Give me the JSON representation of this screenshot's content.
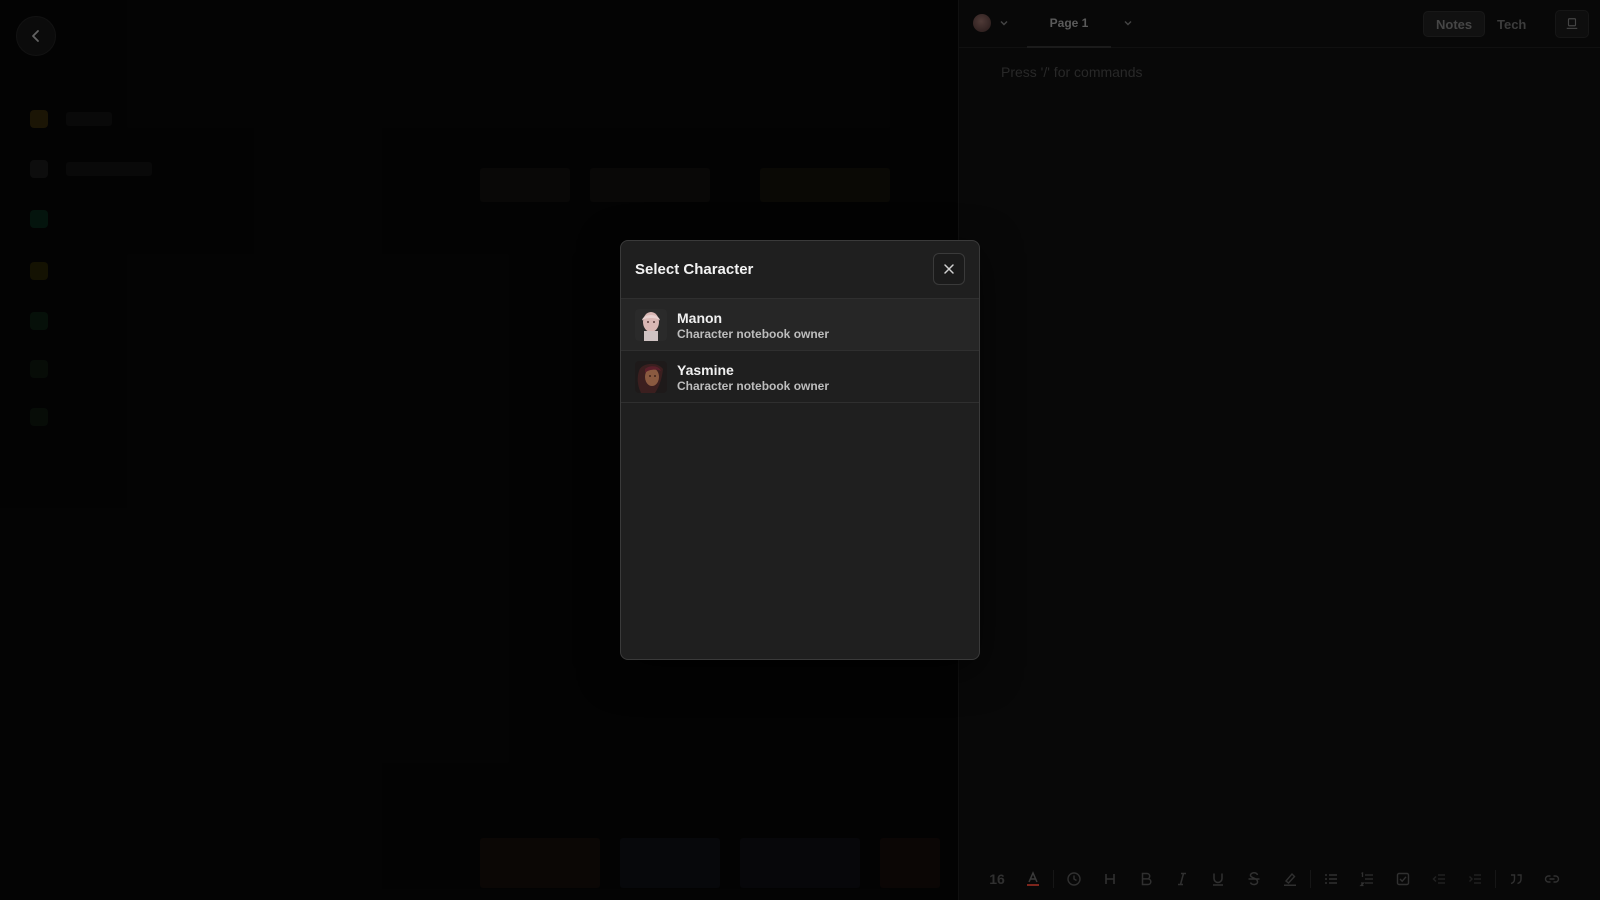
{
  "modal": {
    "title": "Select Character",
    "characters": [
      {
        "name": "Manon",
        "subtitle": "Character notebook owner",
        "avatar_icon": "manon-portrait"
      },
      {
        "name": "Yasmine",
        "subtitle": "Character notebook owner",
        "avatar_icon": "yasmine-portrait"
      }
    ]
  },
  "editor": {
    "page_tab": "Page 1",
    "mode_tabs": {
      "notes": "Notes",
      "tech": "Tech"
    },
    "placeholder": "Press '/' for commands",
    "toolbar": {
      "font_size": "16"
    }
  },
  "colors": {
    "modal_bg": "#1f1f1f",
    "text_color_indicator": "#c0392b"
  }
}
